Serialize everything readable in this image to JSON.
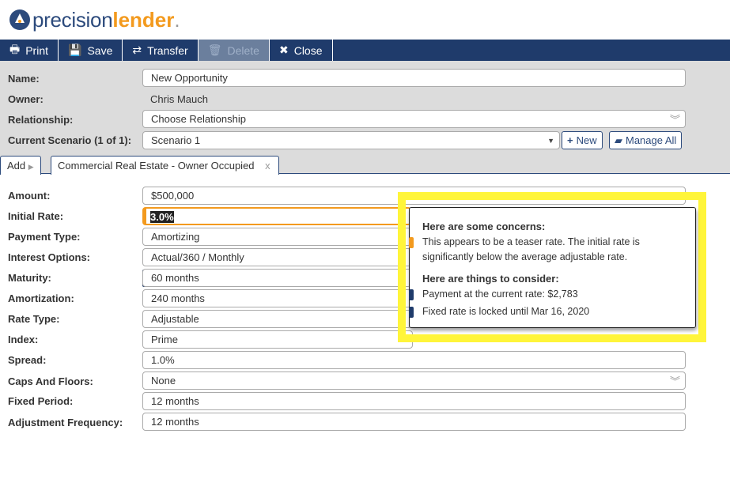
{
  "brand": {
    "part1": "precision",
    "part2": "lender",
    "part3": "."
  },
  "toolbar": [
    {
      "label": "Print",
      "icon": "printer-icon",
      "glyph": "🖶"
    },
    {
      "label": "Save",
      "icon": "floppy-icon",
      "glyph": "💾"
    },
    {
      "label": "Transfer",
      "icon": "transfer-icon",
      "glyph": "⇄"
    },
    {
      "label": "Delete",
      "icon": "trash-icon",
      "glyph": "🗑",
      "disabled": true
    },
    {
      "label": "Close",
      "icon": "close-icon",
      "glyph": "✖"
    }
  ],
  "header": {
    "name_label": "Name:",
    "name_value": "New Opportunity",
    "owner_label": "Owner:",
    "owner_value": "Chris Mauch",
    "relationship_label": "Relationship:",
    "relationship_value": "Choose Relationship",
    "scenario_label": "Current Scenario (1 of 1):",
    "scenario_value": "Scenario 1",
    "new_label": "New",
    "manage_label": "Manage All"
  },
  "tabs": {
    "add": "Add",
    "active": "Commercial Real Estate - Owner Occupied",
    "close": "x"
  },
  "fields": [
    {
      "label": "Amount:",
      "value": "$500,000"
    },
    {
      "label": "Initial Rate:",
      "value": "3.0%",
      "status": "warning"
    },
    {
      "label": "Payment Type:",
      "value": "Amortizing"
    },
    {
      "label": "Interest Options:",
      "value": "Actual/360 / Monthly"
    },
    {
      "label": "Maturity:",
      "value": "60 months",
      "status": "info"
    },
    {
      "label": "Amortization:",
      "value": "240 months"
    },
    {
      "label": "Rate Type:",
      "value": "Adjustable"
    },
    {
      "label": "Index:",
      "value": "Prime"
    },
    {
      "label": "Spread:",
      "value": "1.0%"
    },
    {
      "label": "Caps And Floors:",
      "value": "None"
    },
    {
      "label": "Fixed Period:",
      "value": "12 months"
    },
    {
      "label": "Adjustment Frequency:",
      "value": "12 months"
    }
  ],
  "tooltip": {
    "concerns_title": "Here are some concerns:",
    "concern": "This appears to be a teaser rate. The initial rate is significantly below the average adjustable rate.",
    "consider_title": "Here are things to consider:",
    "considerations": [
      "Payment at the current rate: $2,783",
      "Fixed rate is locked until Mar 16, 2020"
    ]
  },
  "colors": {
    "navy": "#1f3b6b",
    "orange": "#f39a1e",
    "highlight": "#fff53a"
  }
}
